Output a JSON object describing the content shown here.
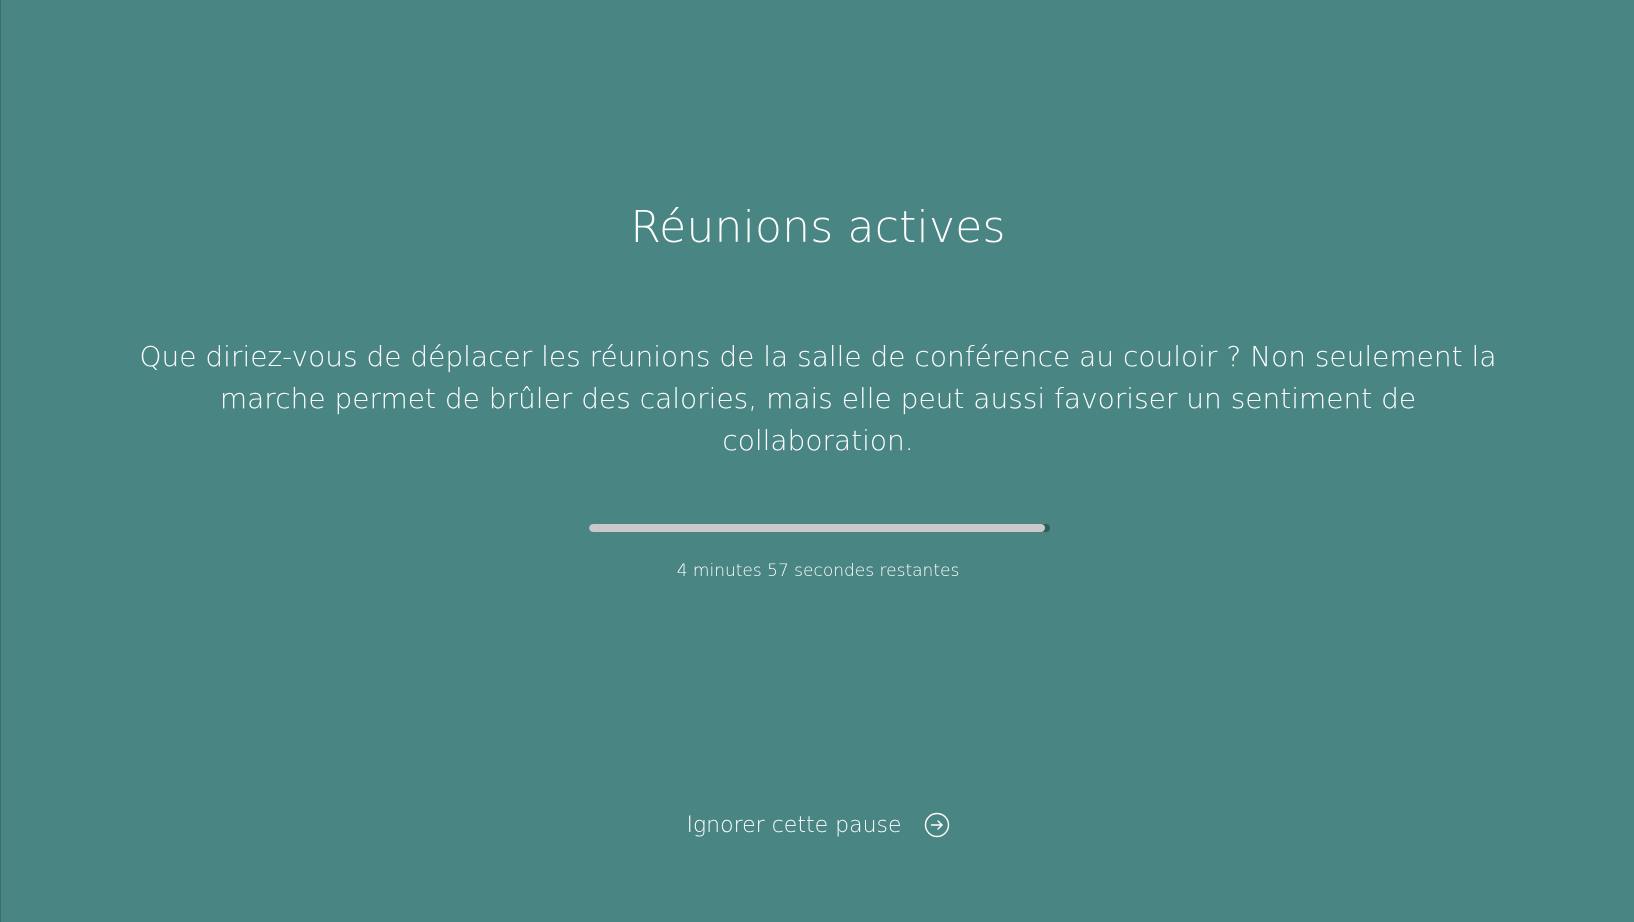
{
  "break": {
    "title": "Réunions actives",
    "message": "Que diriez-vous de déplacer les réunions de la salle de conférence au couloir ? Non seulement la marche permet de brûler des calories, mais elle peut aussi favoriser un sentiment de collaboration.",
    "progress_fraction": 0.99,
    "time_remaining": "4 minutes 57 secondes restantes",
    "skip_label": "Ignorer cette pause",
    "skip_icon": "arrow-right-circle-icon"
  },
  "colors": {
    "background": "#498583",
    "text": "#ffffff",
    "progress_fill": "#c9c9c9",
    "progress_track": "#2f5d5b"
  }
}
